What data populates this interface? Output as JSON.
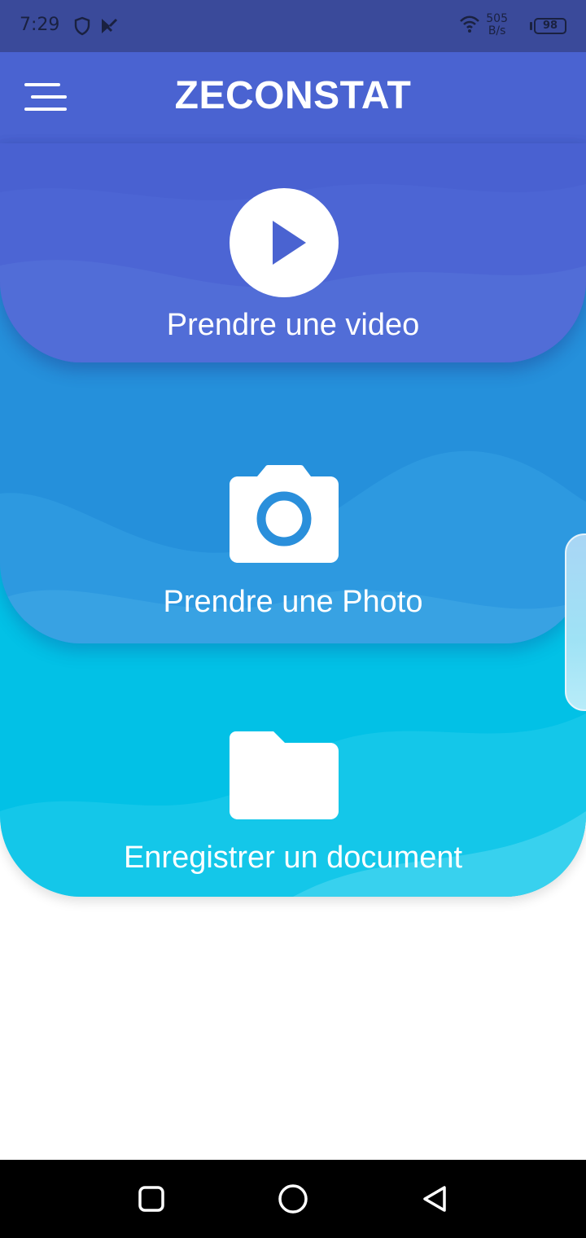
{
  "status_bar": {
    "time": "7:29",
    "speed_top": "505",
    "speed_bottom": "B/s",
    "battery": "98"
  },
  "app_bar": {
    "title": "ZECONSTAT",
    "menu_icon": "hamburger-menu-icon"
  },
  "actions": [
    {
      "label": "Prendre une video",
      "icon": "play-circle-icon",
      "color": "#4a63d1"
    },
    {
      "label": "Prendre une Photo",
      "icon": "camera-icon",
      "color": "#2a8fdb"
    },
    {
      "label": "Enregistrer un document",
      "icon": "folder-icon",
      "color": "#10c2e6"
    }
  ],
  "nav_bar": {
    "recents": "square-recents-icon",
    "home": "circle-home-icon",
    "back": "triangle-back-icon"
  }
}
